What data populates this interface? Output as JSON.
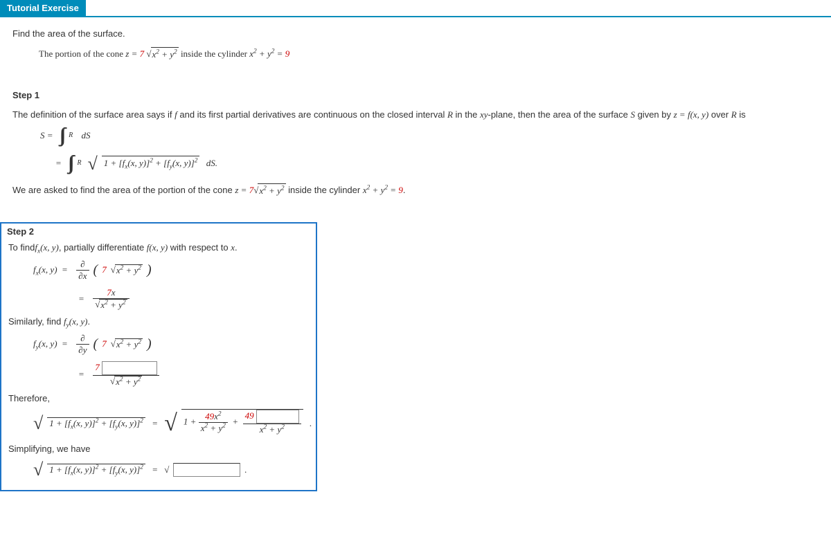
{
  "tab": {
    "title": "Tutorial Exercise"
  },
  "intro": {
    "line1": "Find the area of the surface.",
    "line2_a": "The portion of the cone ",
    "line2_b": " inside the cylinder ",
    "cone_lhs": "z = ",
    "seven": "7",
    "sq_xy": "x² + y²",
    "cyl_eq": "x² + y² = ",
    "nine": "9"
  },
  "step1": {
    "title": "Step 1",
    "def_a": "The definition of the surface area says if ",
    "f": "f",
    "def_b": " and its first partial derivatives are continuous on the closed interval ",
    "R": "R",
    "def_c": " in the ",
    "xy": "xy",
    "def_d": "-plane, then the area of the surface ",
    "S": "S",
    "def_e": " given by ",
    "zfxy": "z = f(x, y)",
    "def_f": " over ",
    "def_g": " is",
    "S_eq": "S = ",
    "dS": " dS",
    "eq": "= ",
    "integrand": "1 + [fₓ(x, y)]² + [f_y(x, y)]²",
    "dS2": " dS.",
    "ask_a": "We are asked to find the area of the portion of the cone ",
    "ask_b": " inside the cylinder",
    "cyl2": "x² + y² = ",
    "dot": "."
  },
  "step2": {
    "title": "Step 2",
    "intro_a": "To find",
    "fx": "fₓ(x, y)",
    "intro_b": ", partially differentiate ",
    "fxy": "f(x, y)",
    "intro_c": " with respect to ",
    "x": "x",
    "intro_d": ".",
    "fx_eq": "fₓ(x, y)  =  ",
    "partial_x": "∂",
    "dx": "∂x",
    "seven": "7",
    "sq_xy": "x² + y²",
    "eq": "=  ",
    "num7x": "7x",
    "sim_a": "Similarly, find ",
    "fy": "f_y(x, y)",
    "sim_b": ".",
    "fy_eq": "f_y(x, y)  =  ",
    "dy": "∂y",
    "therefore": "Therefore,",
    "lhs_rad": "1 + [fₓ(x, y)]² + [f_y(x, y)]²",
    "one_plus": "1 + ",
    "num49x2": "49x²",
    "plus": " + ",
    "num49": "49",
    "simp": "Simplifying, we have",
    "eq2": "  =  "
  }
}
